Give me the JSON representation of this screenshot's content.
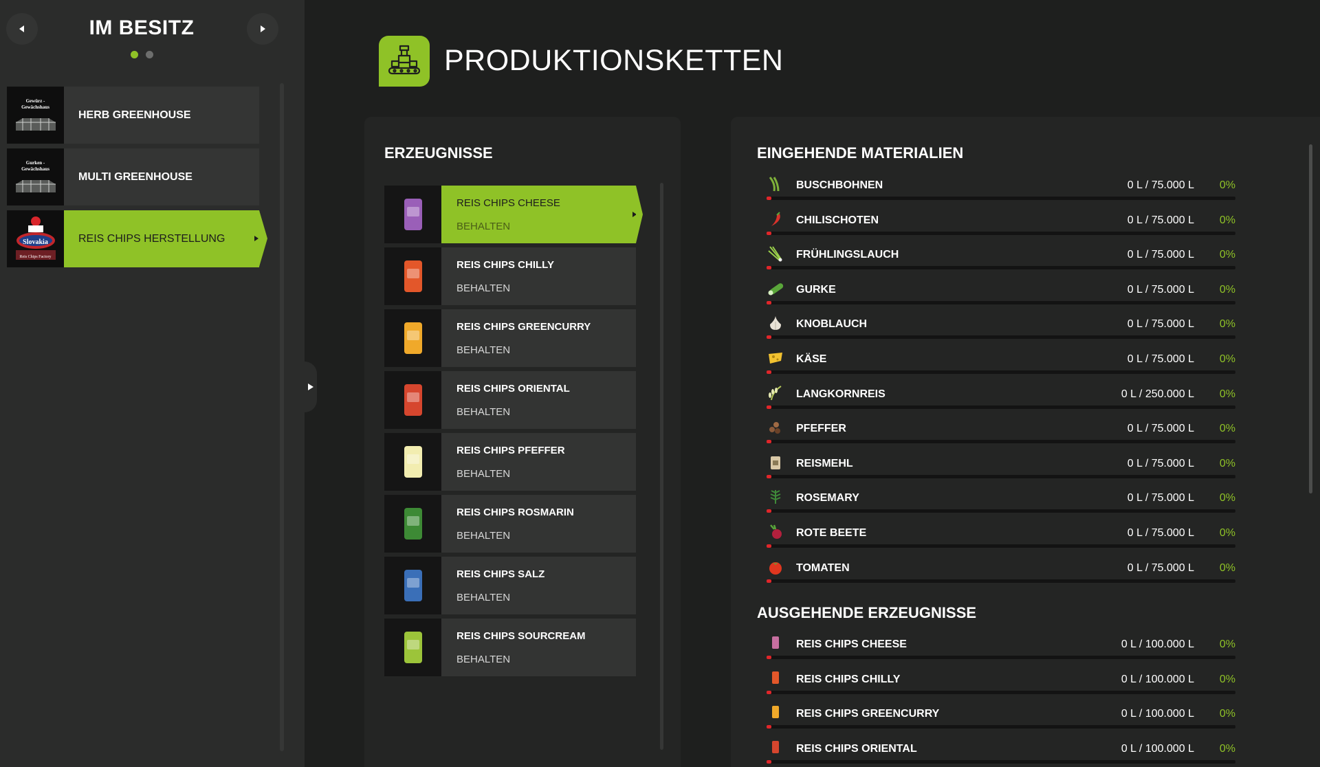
{
  "colors": {
    "accent": "#8fc227",
    "empty_bar": "#e0262a",
    "background": "#1e1f1e"
  },
  "owned": {
    "title": "IM BESITZ",
    "prev_icon": "chevron-left-icon",
    "next_icon": "chevron-right-icon",
    "page_dots": 2,
    "active_page": 1,
    "items": [
      {
        "label": "HERB GREENHOUSE",
        "thumb_text": [
          "Gewürz -",
          "Gewächshaus"
        ],
        "selected": false
      },
      {
        "label": "MULTI GREENHOUSE",
        "thumb_text": [
          "Gurken -",
          "Gewächshaus"
        ],
        "selected": false
      },
      {
        "label": "REIS CHIPS HERSTELLUNG",
        "thumb_text": [
          "Slovakia",
          "Reis Chips Factory"
        ],
        "selected": true
      }
    ]
  },
  "header": {
    "title": "PRODUKTIONSKETTEN",
    "icon": "factory-icon"
  },
  "products": {
    "title": "ERZEUGNISSE",
    "items": [
      {
        "name": "REIS CHIPS CHEESE",
        "mode": "BEHALTEN",
        "bag_color": "#9a5fb8",
        "selected": true
      },
      {
        "name": "REIS CHIPS CHILLY",
        "mode": "BEHALTEN",
        "bag_color": "#e3572a",
        "selected": false
      },
      {
        "name": "REIS CHIPS GREENCURRY",
        "mode": "BEHALTEN",
        "bag_color": "#f0a92a",
        "selected": false
      },
      {
        "name": "REIS CHIPS ORIENTAL",
        "mode": "BEHALTEN",
        "bag_color": "#d6462e",
        "selected": false
      },
      {
        "name": "REIS CHIPS PFEFFER",
        "mode": "BEHALTEN",
        "bag_color": "#f2edb0",
        "selected": false
      },
      {
        "name": "REIS CHIPS ROSMARIN",
        "mode": "BEHALTEN",
        "bag_color": "#3d8a35",
        "selected": false
      },
      {
        "name": "REIS CHIPS SALZ",
        "mode": "BEHALTEN",
        "bag_color": "#3a6fb8",
        "selected": false
      },
      {
        "name": "REIS CHIPS SOURCREAM",
        "mode": "BEHALTEN",
        "bag_color": "#9cc43a",
        "selected": false
      }
    ]
  },
  "incoming": {
    "title": "EINGEHENDE MATERIALIEN",
    "items": [
      {
        "name": "BUSCHBOHNEN",
        "amount": "0 L / 75.000 L",
        "percent": "0%",
        "icon": "bean-icon",
        "color": "#7fb23a"
      },
      {
        "name": "CHILISCHOTEN",
        "amount": "0 L / 75.000 L",
        "percent": "0%",
        "icon": "chili-icon",
        "color": "#d9322b"
      },
      {
        "name": "FRÜHLINGSLAUCH",
        "amount": "0 L / 75.000 L",
        "percent": "0%",
        "icon": "spring-onion-icon",
        "color": "#9ad04a"
      },
      {
        "name": "GURKE",
        "amount": "0 L / 75.000 L",
        "percent": "0%",
        "icon": "cucumber-icon",
        "color": "#5aa63a"
      },
      {
        "name": "KNOBLAUCH",
        "amount": "0 L / 75.000 L",
        "percent": "0%",
        "icon": "garlic-icon",
        "color": "#e8e2d6"
      },
      {
        "name": "KÄSE",
        "amount": "0 L / 75.000 L",
        "percent": "0%",
        "icon": "cheese-icon",
        "color": "#f2c230"
      },
      {
        "name": "LANGKORNREIS",
        "amount": "0 L / 250.000 L",
        "percent": "0%",
        "icon": "rice-icon",
        "color": "#b6c95a"
      },
      {
        "name": "PFEFFER",
        "amount": "0 L / 75.000 L",
        "percent": "0%",
        "icon": "pepper-icon",
        "color": "#8a5a3a"
      },
      {
        "name": "REISMEHL",
        "amount": "0 L / 75.000 L",
        "percent": "0%",
        "icon": "flour-icon",
        "color": "#d9c8a6"
      },
      {
        "name": "ROSEMARY",
        "amount": "0 L / 75.000 L",
        "percent": "0%",
        "icon": "rosemary-icon",
        "color": "#3f8a3a"
      },
      {
        "name": "ROTE BEETE",
        "amount": "0 L / 75.000 L",
        "percent": "0%",
        "icon": "beetroot-icon",
        "color": "#b3203d"
      },
      {
        "name": "TOMATEN",
        "amount": "0 L / 75.000 L",
        "percent": "0%",
        "icon": "tomato-icon",
        "color": "#e0371f"
      }
    ]
  },
  "outgoing": {
    "title": "AUSGEHENDE ERZEUGNISSE",
    "items": [
      {
        "name": "REIS CHIPS CHEESE",
        "amount": "0 L / 100.000 L",
        "percent": "0%",
        "icon": "chips-bag-icon",
        "color": "#c76fa0"
      },
      {
        "name": "REIS CHIPS CHILLY",
        "amount": "0 L / 100.000 L",
        "percent": "0%",
        "icon": "chips-bag-icon",
        "color": "#e3572a"
      },
      {
        "name": "REIS CHIPS GREENCURRY",
        "amount": "0 L / 100.000 L",
        "percent": "0%",
        "icon": "chips-bag-icon",
        "color": "#f0a92a"
      },
      {
        "name": "REIS CHIPS ORIENTAL",
        "amount": "0 L / 100.000 L",
        "percent": "0%",
        "icon": "chips-bag-icon",
        "color": "#d6462e"
      }
    ]
  }
}
